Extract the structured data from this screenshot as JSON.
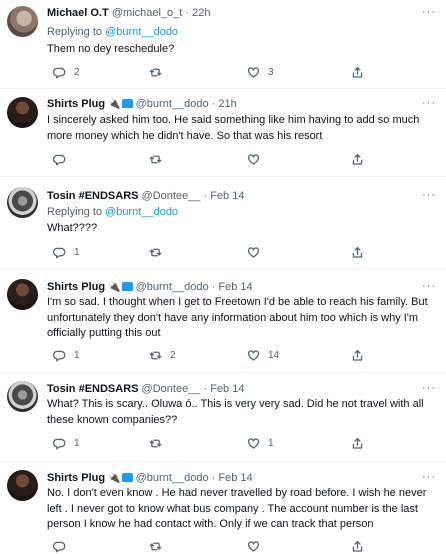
{
  "tweets": [
    {
      "name": "Michael O.T",
      "handle": "@michael_o_t",
      "time": "22h",
      "replying_label": "Replying to",
      "replying_to": "@burnt__dodo",
      "text": "Them no dey reschedule?",
      "replies": "2",
      "retweets": "",
      "likes": "3"
    },
    {
      "name": "Shirts Plug",
      "handle": "@burnt__dodo",
      "time": "21h",
      "text": "I sincerely asked him too. He said something like him having to add so much more money which he didn't have. So that was his resort",
      "replies": "",
      "retweets": "",
      "likes": ""
    },
    {
      "name": "Tosin #ENDSARS",
      "handle": "@Dontee__",
      "time": "Feb 14",
      "replying_label": "Replying to",
      "replying_to": "@burnt__dodo",
      "text": "What????",
      "replies": "1",
      "retweets": "",
      "likes": ""
    },
    {
      "name": "Shirts Plug",
      "handle": "@burnt__dodo",
      "time": "Feb 14",
      "text": "I'm so sad. I thought when I get to Freetown I'd be able to reach his family. But unfortunately they don't have any information about him too which is why I'm officially putting this out",
      "replies": "1",
      "retweets": "2",
      "likes": "14"
    },
    {
      "name": "Tosin #ENDSARS",
      "handle": "@Dontee__",
      "time": "Feb 14",
      "text": "What? This is scary.. Oluwa ó.. This is very very sad. Did he not travel with all these known companies??",
      "replies": "1",
      "retweets": "",
      "likes": "1"
    },
    {
      "name": "Shirts Plug",
      "handle": "@burnt__dodo",
      "time": "Feb 14",
      "text": "No. I don't even know . He had never travelled by road before. I wish he never left . I never got to know what bus company . The account number is the last person I know he had contact with. Only if we can track that person",
      "replies": "",
      "retweets": "",
      "likes": ""
    }
  ],
  "ui": {
    "dot": "·",
    "more": "···"
  },
  "icons": {
    "reply": "reply-icon",
    "retweet": "retweet-icon",
    "like": "heart-icon",
    "share": "share-icon"
  },
  "colors": {
    "link": "#1d9bf0",
    "muted": "#536471",
    "text": "#0f1419",
    "divider": "#eff3f4"
  }
}
